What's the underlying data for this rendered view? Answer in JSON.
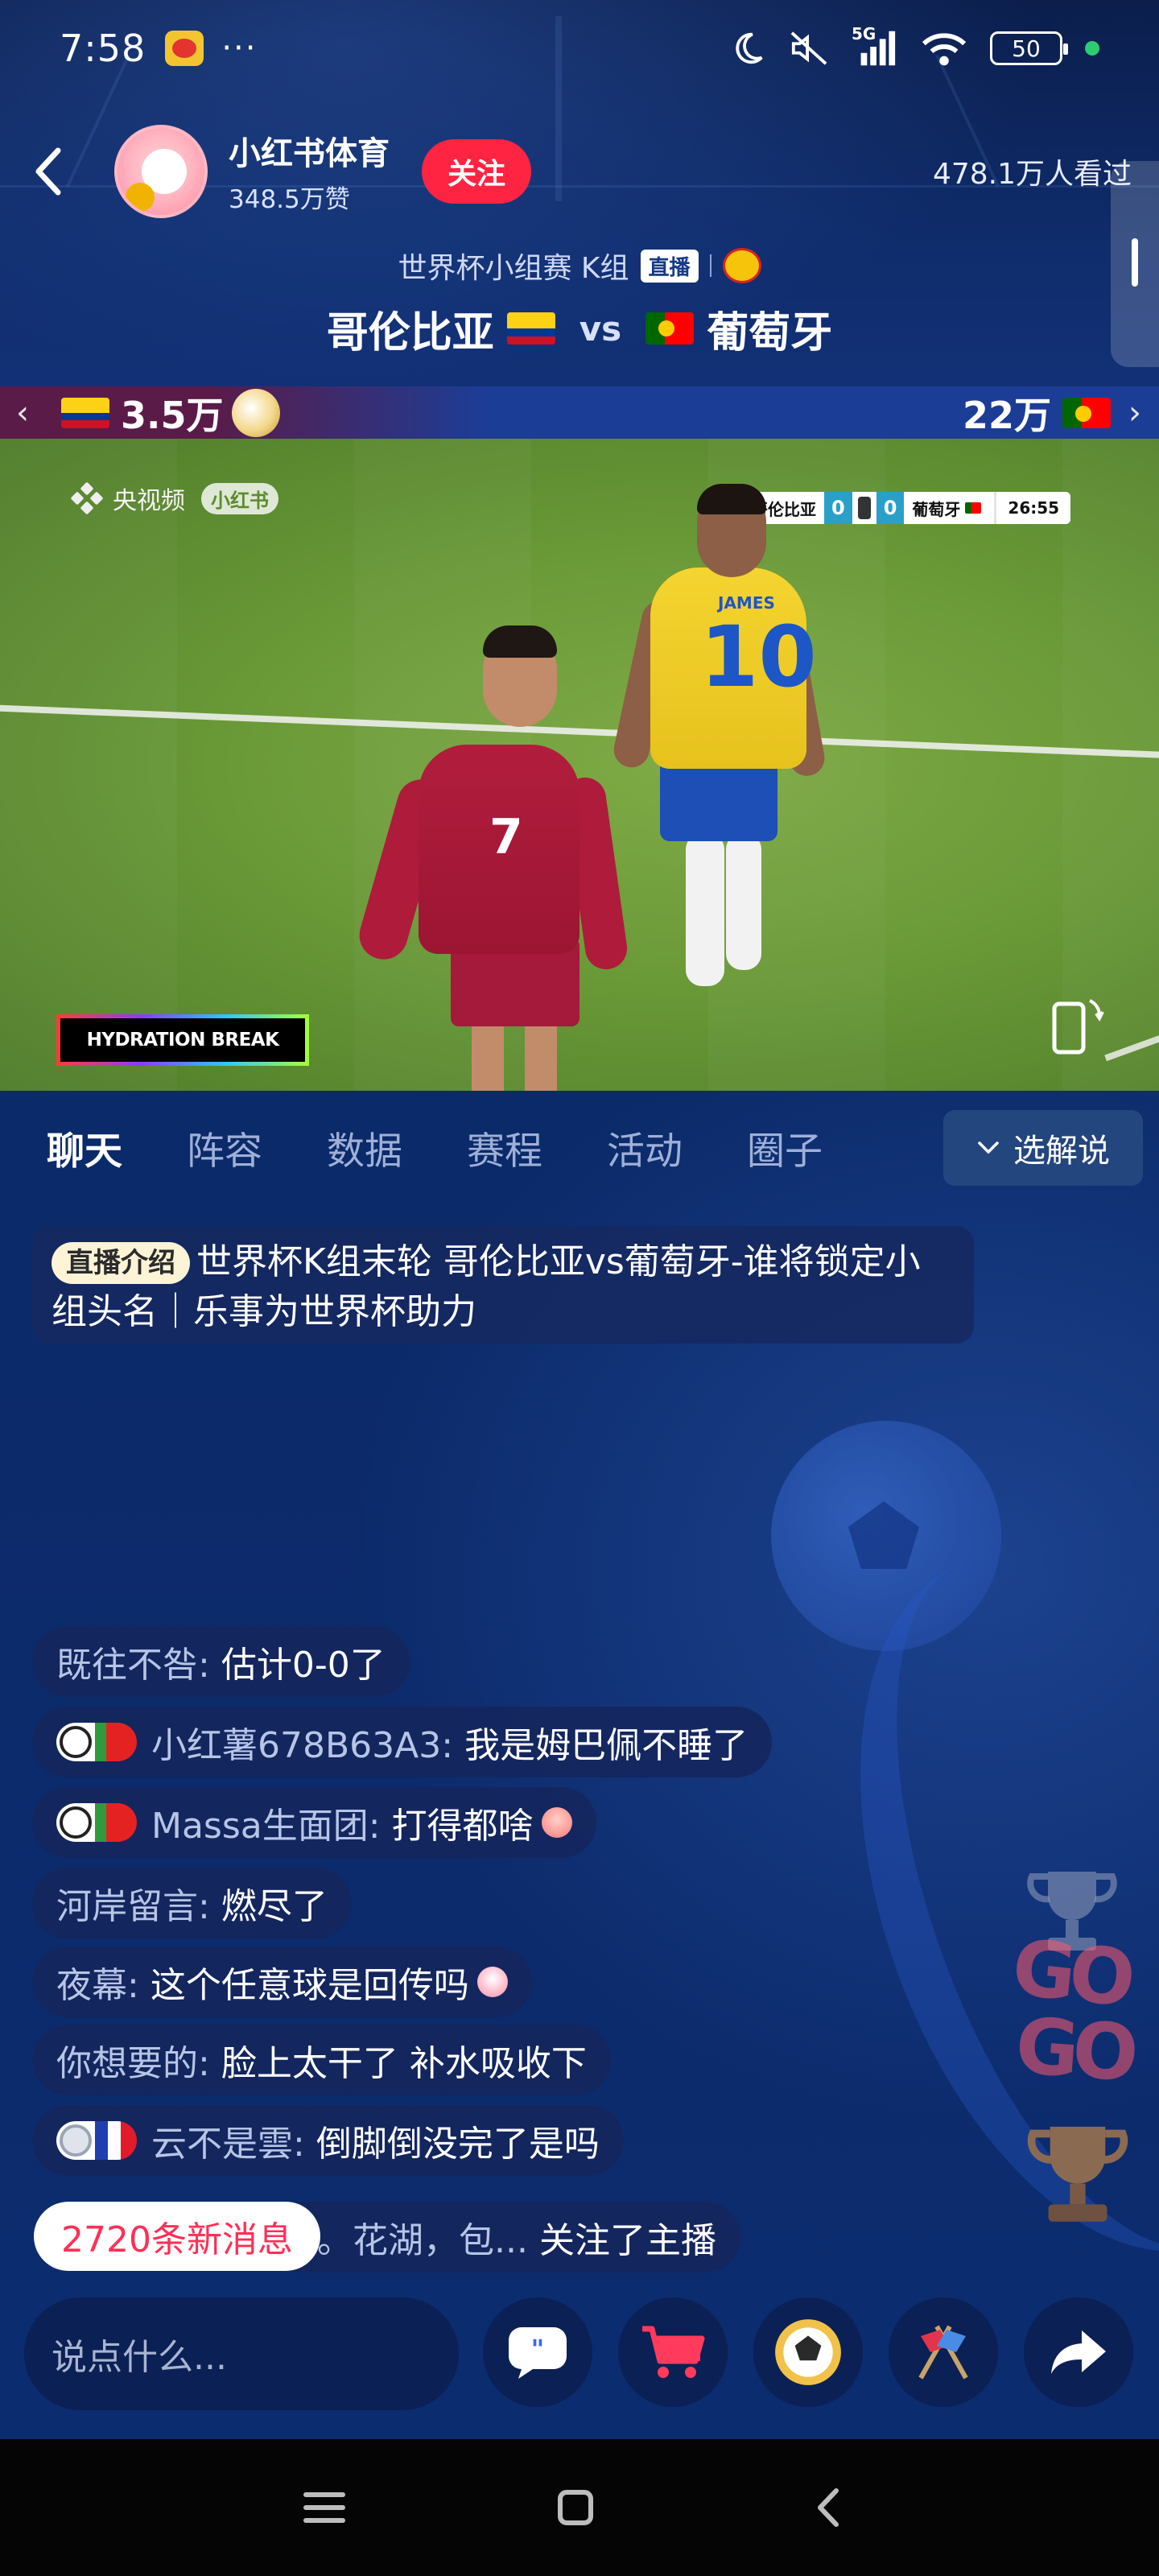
{
  "status_bar": {
    "time": "7:58",
    "dots": "···",
    "network": "5G",
    "battery": "50"
  },
  "header": {
    "host_name": "小红书体育",
    "host_likes": "348.5万赞",
    "follow_label": "关注",
    "viewer_count": "478.1万人看过"
  },
  "match": {
    "stage": "世界杯小组赛 K组",
    "live_badge": "直播",
    "home_team": "哥伦比亚",
    "away_team": "葡萄牙",
    "vs": "vs"
  },
  "support": {
    "home_value": "3.5万",
    "away_value": "22万"
  },
  "video": {
    "broadcaster": "央视频",
    "watermark": "小红书",
    "scoreboard": {
      "home": "哥伦比亚",
      "home_score": "0",
      "away_score": "0",
      "away": "葡萄牙",
      "clock": "26:55"
    },
    "portugal_number": "7",
    "colombia_number": "10",
    "colombia_name": "JAMES",
    "banner": "HYDRATION BREAK"
  },
  "tabs": [
    "聊天",
    "阵容",
    "数据",
    "赛程",
    "活动",
    "圈子"
  ],
  "active_tab": "聊天",
  "commentary_button": "选解说",
  "intro": {
    "badge": "直播介绍",
    "text": "世界杯K组末轮 哥伦比亚vs葡萄牙-谁将锁定小组头名｜乐事为世界杯助力"
  },
  "chat": [
    {
      "user": "既往不咎:",
      "text": "估计0-0了"
    },
    {
      "user": "小红薯678B63A3:",
      "text": "我是姆巴佩不睡了"
    },
    {
      "user": "Massa生面团:",
      "text": "打得都啥"
    },
    {
      "user": "河岸留言:",
      "text": "燃尽了"
    },
    {
      "user": "夜幕:",
      "text": "这个任意球是回传吗"
    },
    {
      "user": "你想要的:",
      "text": "脸上太干了 补水吸收下"
    },
    {
      "user": "云不是雲:",
      "text": "倒脚倒没完了是吗"
    },
    {
      "user": "寺。花湖，包...",
      "text": "关注了主播"
    }
  ],
  "new_messages": "2720条新消息",
  "input_placeholder": "说点什么...",
  "colors": {
    "follow": "#ff2442",
    "background": "#0c2a66",
    "new_messages_text": "#ff2f56"
  },
  "icons": [
    "back-icon",
    "chevron-down-icon",
    "comment-icon",
    "cart-icon",
    "ball-icon",
    "flags-icon",
    "share-icon",
    "rotate-screen-icon"
  ]
}
